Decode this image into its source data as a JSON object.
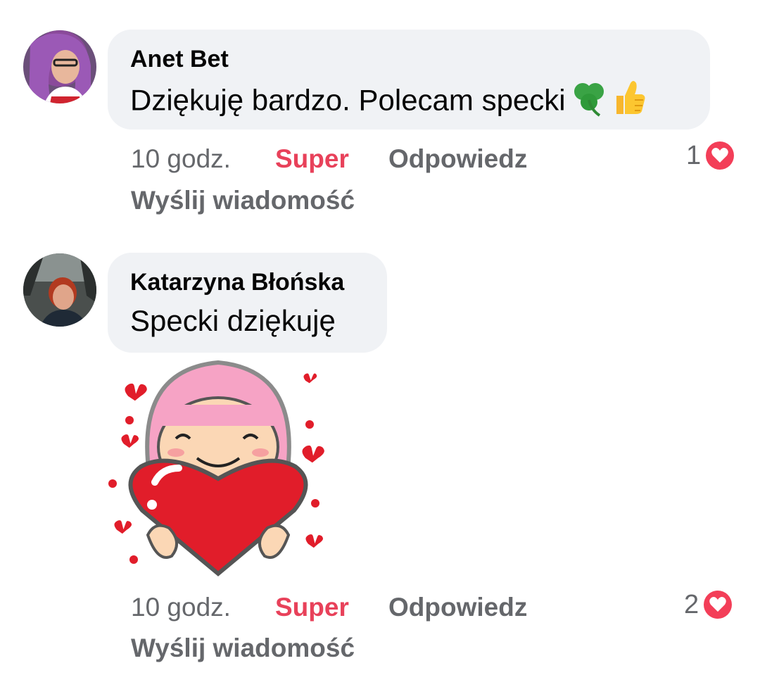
{
  "comments": [
    {
      "author": "Anet Bet",
      "text": "Dziękuję bardzo. Polecam specki",
      "emojis": [
        "shamrock-icon",
        "thumbs-up-icon"
      ],
      "time": "10 godz.",
      "reaction_label": "Super",
      "reply_label": "Odpowiedz",
      "message_label": "Wyślij wiadomość",
      "reaction_count": "1",
      "colors": {
        "reaction": "#e8415a",
        "bubble": "#f0f2f5"
      }
    },
    {
      "author": "Katarzyna Błońska",
      "text": "Specki dziękuję",
      "sticker": "girl-hugging-heart-sticker",
      "time": "10 godz.",
      "reaction_label": "Super",
      "reply_label": "Odpowiedz",
      "message_label": "Wyślij wiadomość",
      "reaction_count": "2",
      "colors": {
        "reaction": "#e8415a",
        "bubble": "#f0f2f5"
      }
    }
  ]
}
